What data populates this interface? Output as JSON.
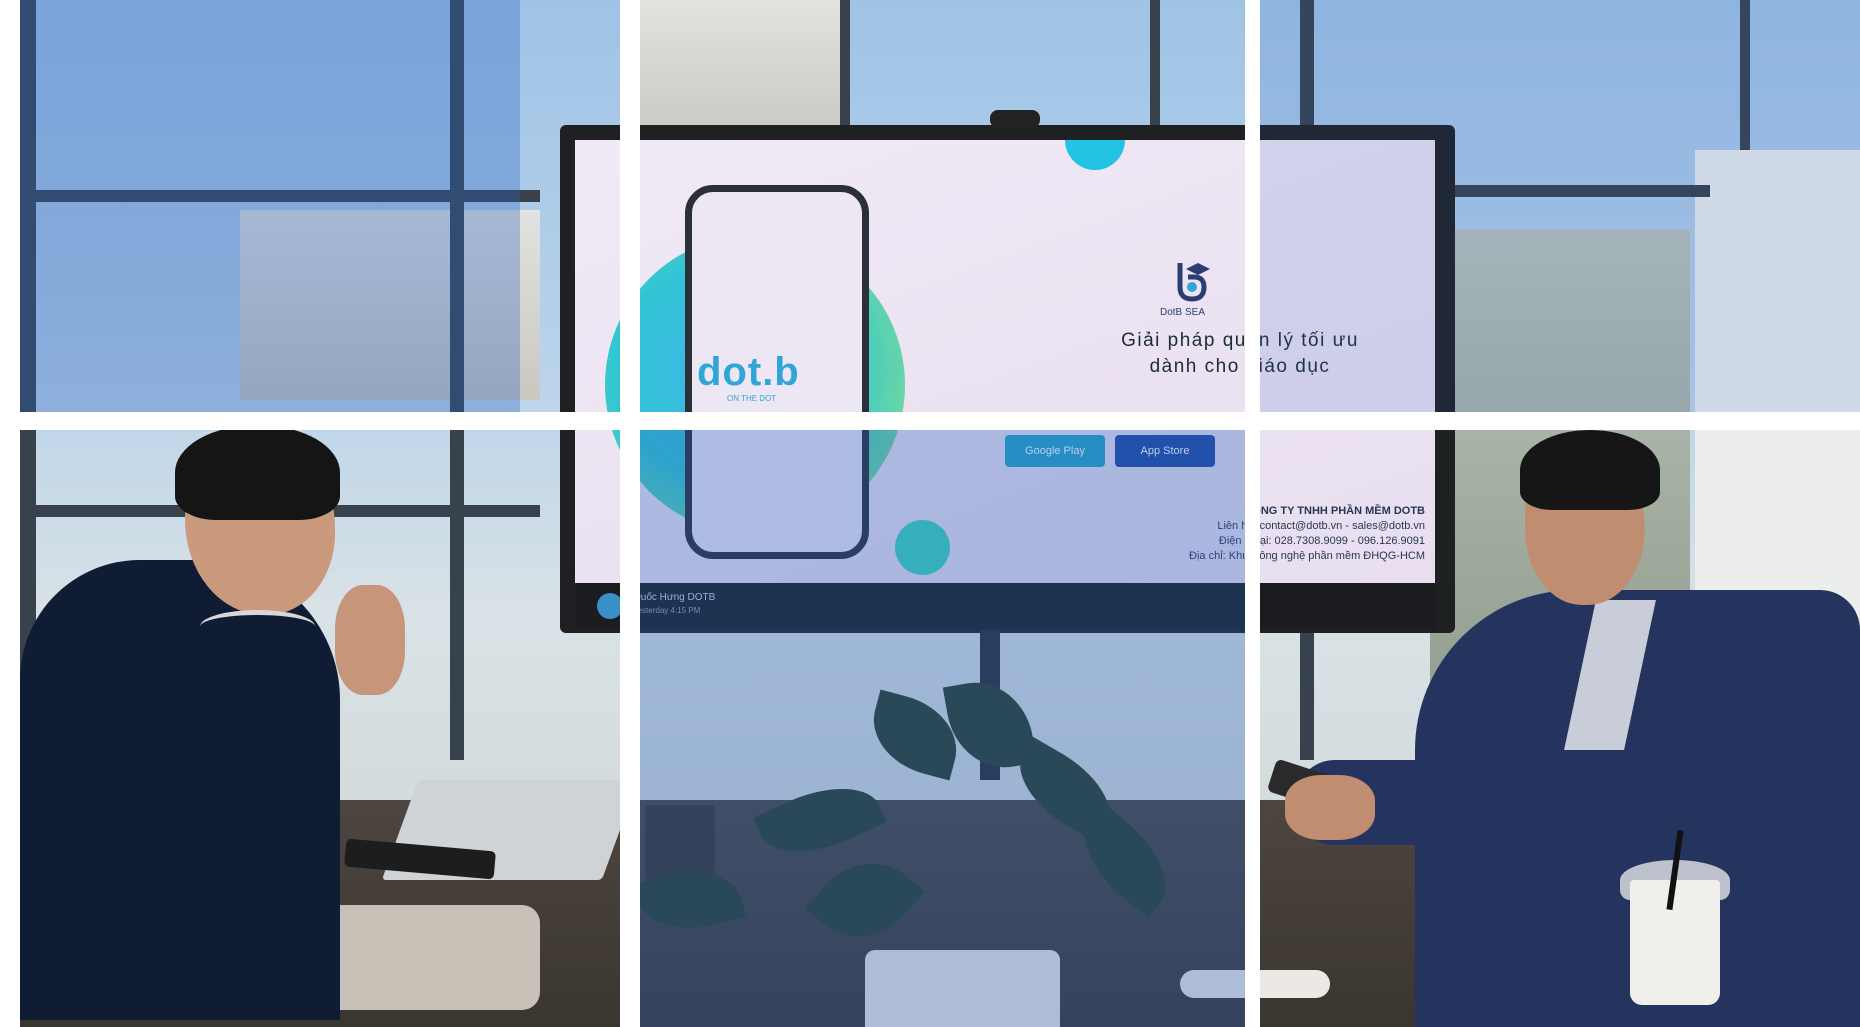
{
  "screen": {
    "app_logo": "dot.b",
    "app_logo_tagline": "ON THE DOT",
    "brand_name": "DotB SEA",
    "headline_line1": "Giải pháp quản lý tối ưu",
    "headline_line2": "dành cho giáo dục",
    "store_buttons": [
      "Google Play",
      "App Store"
    ],
    "company_name": "CÔNG TY TNHH PHẦN MỀM DOTB",
    "contact_line": "Liên hệ: contact@dotb.vn - sales@dotb.vn",
    "phone_line": "Điện thoại: 028.7308.9099 - 096.126.9091",
    "address_line": "Địa chỉ: Khu Công nghệ phần mềm ĐHQG-HCM",
    "taskbar_user": "Quốc Hưng DOTB",
    "taskbar_time": "Yesterday 4:15 PM"
  },
  "colors": {
    "tint": "#285fbe",
    "screen_bg": "#ebe2f1",
    "accent_teal": "#2fa6d6",
    "jacket": "#24345e",
    "polo": "#101c34"
  }
}
